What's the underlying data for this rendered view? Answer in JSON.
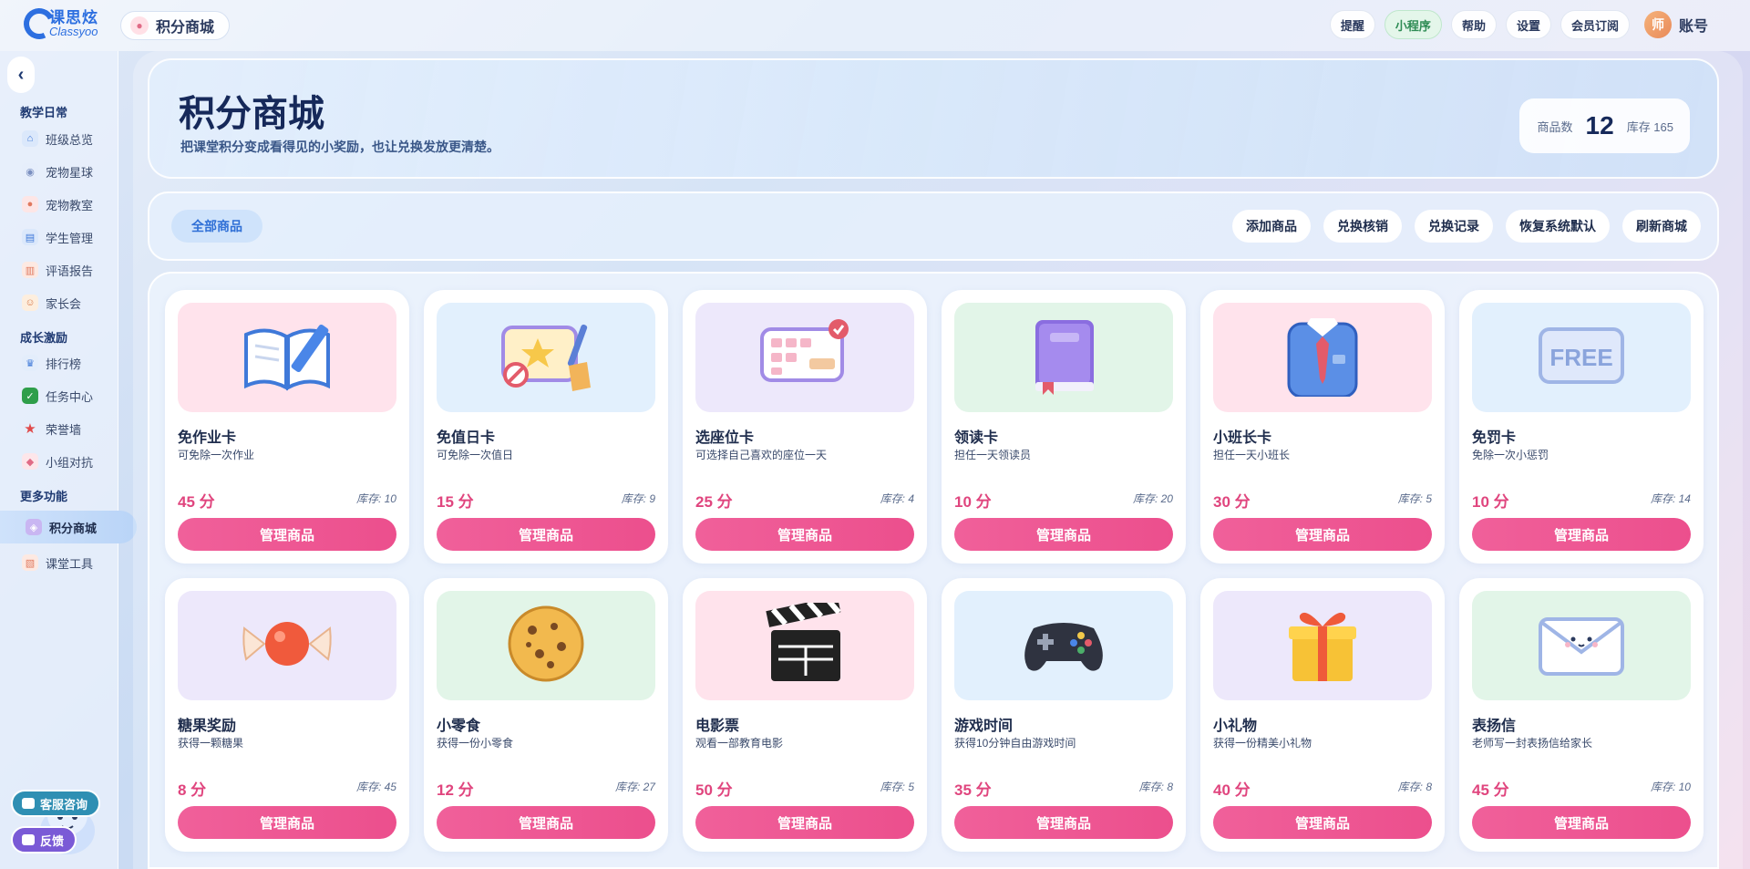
{
  "app": {
    "logo_cn": "课思炫",
    "logo_en": "Classyoo",
    "page_pill": "积分商城"
  },
  "top_actions": [
    "提醒",
    "小程序",
    "帮助",
    "设置",
    "会员订阅"
  ],
  "account": {
    "avatar_text": "师",
    "label": "账号"
  },
  "sidebar": {
    "collapse": "‹",
    "groups": [
      {
        "title": "教学日常",
        "items": [
          "班级总览",
          "宠物星球",
          "宠物教室",
          "学生管理",
          "评语报告",
          "家长会"
        ]
      },
      {
        "title": "成长激励",
        "items": [
          "排行榜",
          "任务中心",
          "荣誉墙",
          "小组对抗"
        ]
      },
      {
        "title": "更多功能",
        "items": [
          "积分商城",
          "课堂工具"
        ]
      }
    ],
    "active": "积分商城",
    "help": "客服咨询",
    "feedback": "反馈"
  },
  "hero": {
    "title": "积分商城",
    "subtitle": "把课堂积分变成看得见的小奖励，也让兑换发放更清楚。",
    "stats_label": "商品数",
    "stats_count": "12",
    "stock_label": "库存 165"
  },
  "toolbar": {
    "filter_all": "全部商品",
    "actions": [
      "添加商品",
      "兑换核销",
      "兑换记录",
      "恢复系统默认",
      "刷新商城"
    ]
  },
  "products": [
    {
      "name": "免作业卡",
      "desc": "可免除一次作业",
      "points": "45 分",
      "stock": "库存: 10",
      "icon": "book-pencil-icon",
      "bg": "pink"
    },
    {
      "name": "免值日卡",
      "desc": "可免除一次值日",
      "points": "15 分",
      "stock": "库存: 9",
      "icon": "broom-ticket-icon",
      "bg": "blue"
    },
    {
      "name": "选座位卡",
      "desc": "可选择自己喜欢的座位一天",
      "points": "25 分",
      "stock": "库存: 4",
      "icon": "seat-ticket-icon",
      "bg": "lav"
    },
    {
      "name": "领读卡",
      "desc": "担任一天领读员",
      "points": "10 分",
      "stock": "库存: 20",
      "icon": "purple-book-icon",
      "bg": "green"
    },
    {
      "name": "小班长卡",
      "desc": "担任一天小班长",
      "points": "30 分",
      "stock": "库存: 5",
      "icon": "shirt-tie-icon",
      "bg": "pink"
    },
    {
      "name": "免罚卡",
      "desc": "免除一次小惩罚",
      "points": "10 分",
      "stock": "库存: 14",
      "icon": "free-ticket-icon",
      "bg": "blue"
    },
    {
      "name": "糖果奖励",
      "desc": "获得一颗糖果",
      "points": "8 分",
      "stock": "库存: 45",
      "icon": "candy-icon",
      "bg": "lav"
    },
    {
      "name": "小零食",
      "desc": "获得一份小零食",
      "points": "12 分",
      "stock": "库存: 27",
      "icon": "cookie-icon",
      "bg": "green"
    },
    {
      "name": "电影票",
      "desc": "观看一部教育电影",
      "points": "50 分",
      "stock": "库存: 5",
      "icon": "clapperboard-icon",
      "bg": "pink"
    },
    {
      "name": "游戏时间",
      "desc": "获得10分钟自由游戏时间",
      "points": "35 分",
      "stock": "库存: 8",
      "icon": "gamepad-icon",
      "bg": "blue"
    },
    {
      "name": "小礼物",
      "desc": "获得一份精美小礼物",
      "points": "40 分",
      "stock": "库存: 8",
      "icon": "gift-icon",
      "bg": "lav"
    },
    {
      "name": "表扬信",
      "desc": "老师写一封表扬信给家长",
      "points": "45 分",
      "stock": "库存: 10",
      "icon": "envelope-icon",
      "bg": "green"
    }
  ],
  "manage_label": "管理商品",
  "free_text": "FREE"
}
